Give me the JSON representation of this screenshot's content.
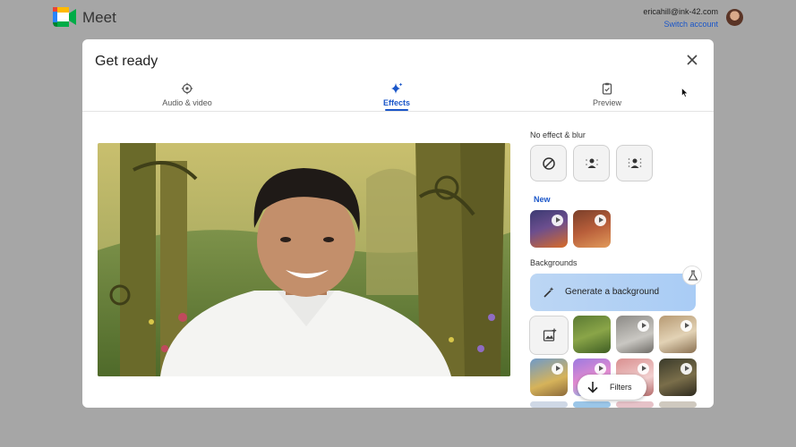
{
  "app": {
    "title": "Meet"
  },
  "account": {
    "email": "ericahill@ink-42.com",
    "switch_label": "Switch account"
  },
  "dialog": {
    "title": "Get ready"
  },
  "tabs": [
    {
      "label": "Audio & video",
      "icon": "audio-video-icon"
    },
    {
      "label": "Effects",
      "icon": "sparkle-icon",
      "active": true
    },
    {
      "label": "Preview",
      "icon": "preview-icon"
    }
  ],
  "effects": {
    "no_effect_label": "No effect & blur",
    "new_label": "New",
    "backgrounds_label": "Backgrounds",
    "generate_label": "Generate a background",
    "filters_label": "Filters"
  },
  "colors": {
    "accent": "#1a56c9",
    "generate_bg": "#b3d1f4"
  }
}
